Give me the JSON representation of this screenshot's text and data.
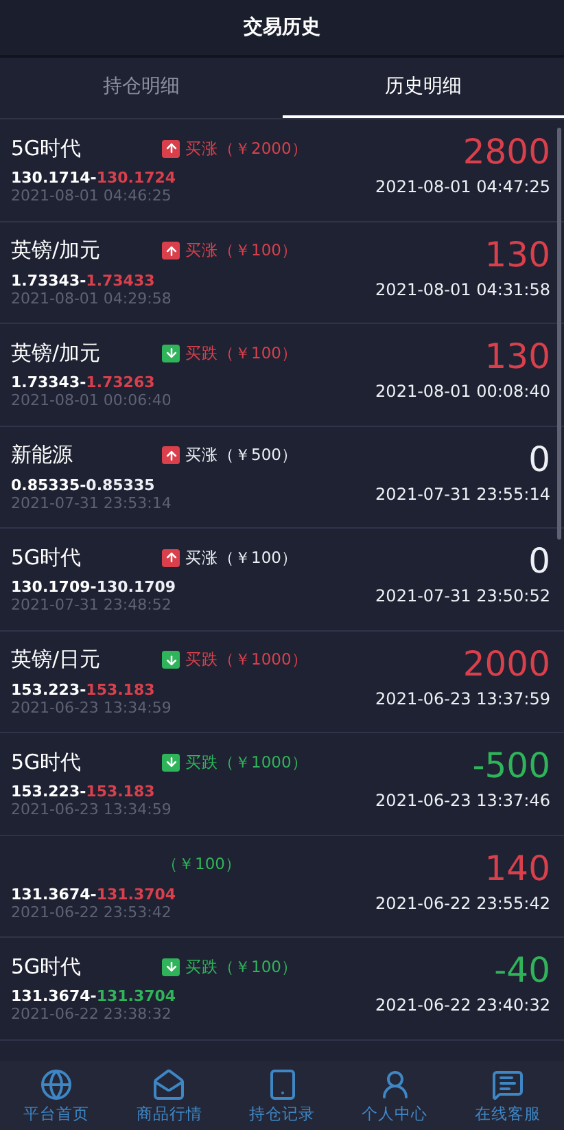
{
  "header": {
    "title": "交易历史"
  },
  "tabs": [
    {
      "label": "持仓明细",
      "selected": false
    },
    {
      "label": "历史明细",
      "selected": true
    }
  ],
  "trades": [
    {
      "name": "5G时代",
      "kind": "up",
      "tag": {
        "text": "买涨（￥2000）",
        "color": "#d9404c"
      },
      "open": "130.1714-",
      "close": {
        "text": "130.1724",
        "color": "#d9404c"
      },
      "open_time": "2021-08-01 04:46:25",
      "profit": {
        "text": "2800",
        "color": "#d9404c"
      },
      "close_time": "2021-08-01 04:47:25"
    },
    {
      "name": "英镑/加元",
      "kind": "up",
      "tag": {
        "text": "买涨（￥100）",
        "color": "#d9404c"
      },
      "open": "1.73343-",
      "close": {
        "text": "1.73433",
        "color": "#d9404c"
      },
      "open_time": "2021-08-01 04:29:58",
      "profit": {
        "text": "130",
        "color": "#d9404c"
      },
      "close_time": "2021-08-01 04:31:58"
    },
    {
      "name": "英镑/加元",
      "kind": "down",
      "tag": {
        "text": "买跌（￥100）",
        "color": "#d9404c"
      },
      "open": "1.73343-",
      "close": {
        "text": "1.73263",
        "color": "#d9404c"
      },
      "open_time": "2021-08-01 00:06:40",
      "profit": {
        "text": "130",
        "color": "#d9404c"
      },
      "close_time": "2021-08-01 00:08:40"
    },
    {
      "name": "新能源",
      "kind": "up",
      "tag": {
        "text": "买涨（￥500）",
        "color": "#eef0f5"
      },
      "open": "0.85335-",
      "close": {
        "text": "0.85335",
        "color": "#eef0f5"
      },
      "open_time": "2021-07-31 23:53:14",
      "profit": {
        "text": "0",
        "color": "#eef0f5"
      },
      "close_time": "2021-07-31 23:55:14"
    },
    {
      "name": "5G时代",
      "kind": "up",
      "tag": {
        "text": "买涨（￥100）",
        "color": "#eef0f5"
      },
      "open": "130.1709-",
      "close": {
        "text": "130.1709",
        "color": "#eef0f5"
      },
      "open_time": "2021-07-31 23:48:52",
      "profit": {
        "text": "0",
        "color": "#eef0f5"
      },
      "close_time": "2021-07-31 23:50:52"
    },
    {
      "name": "英镑/日元",
      "kind": "down",
      "tag": {
        "text": "买跌（￥1000）",
        "color": "#d9404c"
      },
      "open": "153.223-",
      "close": {
        "text": "153.183",
        "color": "#d9404c"
      },
      "open_time": "2021-06-23 13:34:59",
      "profit": {
        "text": "2000",
        "color": "#d9404c"
      },
      "close_time": "2021-06-23 13:37:59"
    },
    {
      "name": "5G时代",
      "kind": "down",
      "tag": {
        "text": "买跌（￥1000）",
        "color": "#2fb45a"
      },
      "open": "153.223-",
      "close": {
        "text": "153.183",
        "color": "#d9404c"
      },
      "open_time": "2021-06-23 13:34:59",
      "profit": {
        "text": "-500",
        "color": "#2fb45a"
      },
      "close_time": "2021-06-23 13:37:46"
    },
    {
      "kind": "plain",
      "tag": {
        "text": "（￥100）",
        "color": "#2fb45a"
      },
      "open": "131.3674-",
      "close": {
        "text": "131.3704",
        "color": "#d9404c"
      },
      "open_time": "2021-06-22 23:53:42",
      "profit": {
        "text": "140",
        "color": "#d9404c"
      },
      "close_time": "2021-06-22 23:55:42"
    },
    {
      "name": "5G时代",
      "kind": "down",
      "tag": {
        "text": "买跌（￥100）",
        "color": "#2fb45a"
      },
      "open": "131.3674-",
      "close": {
        "text": "131.3704",
        "color": "#2fb45a"
      },
      "open_time": "2021-06-22 23:38:32",
      "profit": {
        "text": "-40",
        "color": "#2fb45a"
      },
      "close_time": "2021-06-22 23:40:32"
    }
  ],
  "nav": [
    {
      "label": "平台首页"
    },
    {
      "label": "商品行情"
    },
    {
      "label": "持仓记录"
    },
    {
      "label": "个人中心"
    },
    {
      "label": "在线客服"
    }
  ]
}
